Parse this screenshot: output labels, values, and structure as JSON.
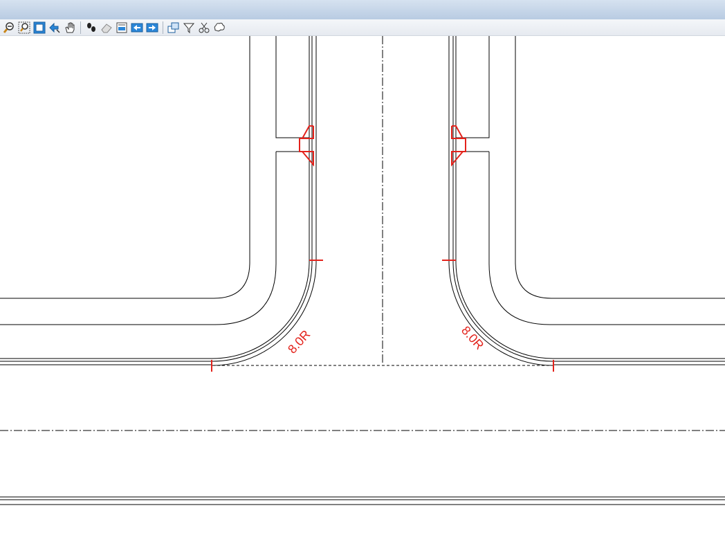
{
  "window": {
    "title": ""
  },
  "toolbar": {
    "groups": [
      {
        "name": "view",
        "icons": [
          "zoom-out-icon",
          "zoom-window-icon",
          "zoom-extents-icon",
          "zoom-realtime-icon",
          "pan-icon"
        ]
      },
      {
        "name": "edit",
        "icons": [
          "footprint-icon",
          "eraser-icon",
          "layer-edit-icon",
          "move-left-icon",
          "move-right-icon"
        ]
      },
      {
        "name": "select",
        "icons": [
          "window-select-icon",
          "filter-select-icon",
          "scissors-select-icon",
          "cloud-select-icon"
        ]
      }
    ]
  },
  "drawing": {
    "left_radius_label": "8.0R",
    "right_radius_label": "8.0R",
    "line_color": "#000000",
    "annotation_color": "#e3221b"
  }
}
